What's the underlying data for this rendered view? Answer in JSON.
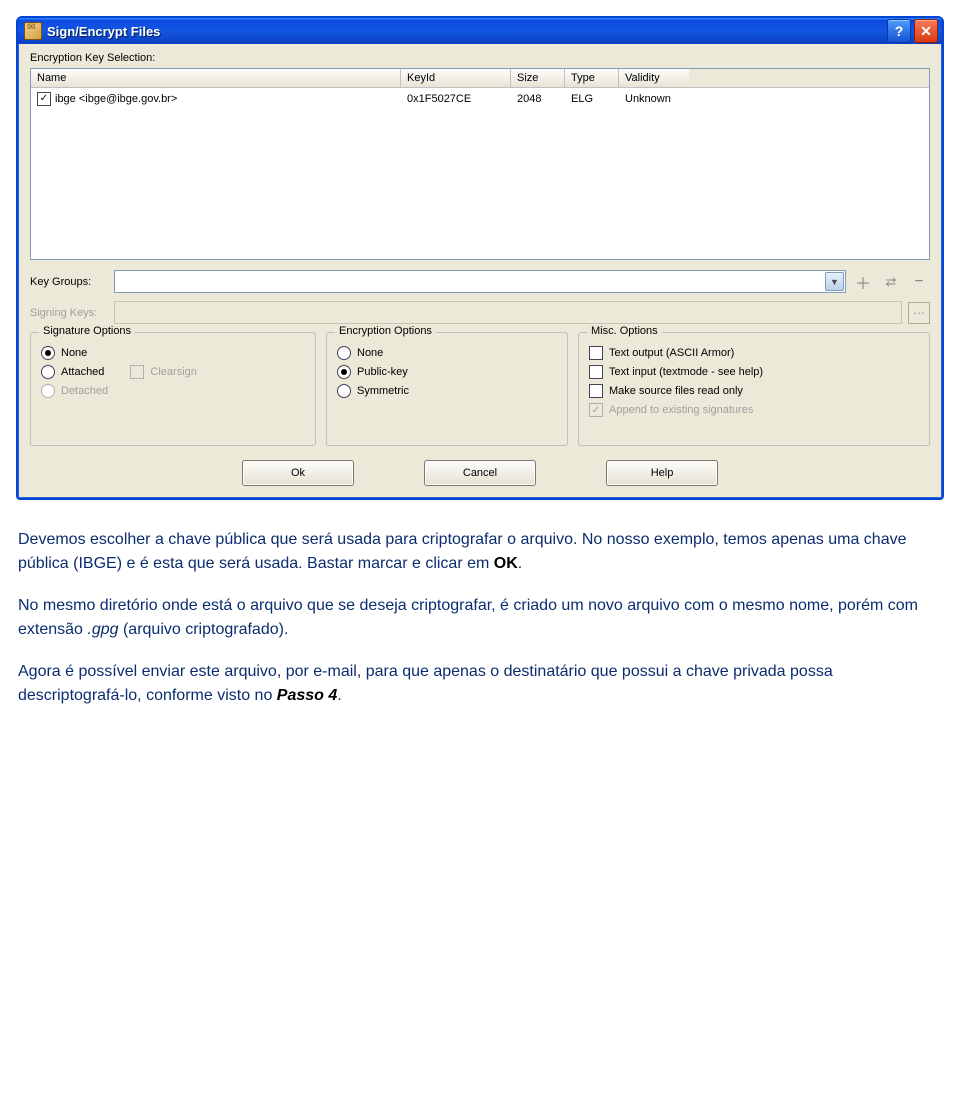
{
  "title": "Sign/Encrypt Files",
  "selection_label": "Encryption Key Selection:",
  "columns": {
    "name": "Name",
    "keyid": "KeyId",
    "size": "Size",
    "type": "Type",
    "validity": "Validity"
  },
  "row": {
    "name": "ibge <ibge@ibge.gov.br>",
    "keyid": "0x1F5027CE",
    "size": "2048",
    "type": "ELG",
    "validity": "Unknown"
  },
  "keygroups_label": "Key Groups:",
  "signing_label": "Signing Keys:",
  "sig_group": "Signature Options",
  "sig": {
    "none": "None",
    "attached": "Attached",
    "clearsign": "Clearsign",
    "detached": "Detached"
  },
  "enc_group": "Encryption Options",
  "enc": {
    "none": "None",
    "pk": "Public-key",
    "sym": "Symmetric"
  },
  "misc_group": "Misc. Options",
  "misc": {
    "ascii": "Text output (ASCII Armor)",
    "textin": "Text input (textmode - see help)",
    "ro": "Make source files read only",
    "append": "Append to existing signatures"
  },
  "buttons": {
    "ok": "Ok",
    "cancel": "Cancel",
    "help": "Help"
  },
  "para1a": "Devemos escolher a chave pública que será usada para criptografar o arquivo. No nosso exemplo, temos apenas uma chave pública (IBGE) e é esta que será usada. Bastar marcar e clicar em ",
  "para1b": "OK",
  "para1c": ".",
  "para2a": "No mesmo diretório onde está o arquivo que se deseja criptografar, é criado um novo arquivo com o mesmo nome, porém com extensão ",
  "para2b": ".gpg",
  "para2c": " (arquivo criptografado).",
  "para3a": "Agora é possível enviar este arquivo, por e-mail, para que apenas o destinatário que possui a chave privada possa descriptografá-lo, conforme visto no ",
  "para3b": "Passo 4",
  "para3c": "."
}
